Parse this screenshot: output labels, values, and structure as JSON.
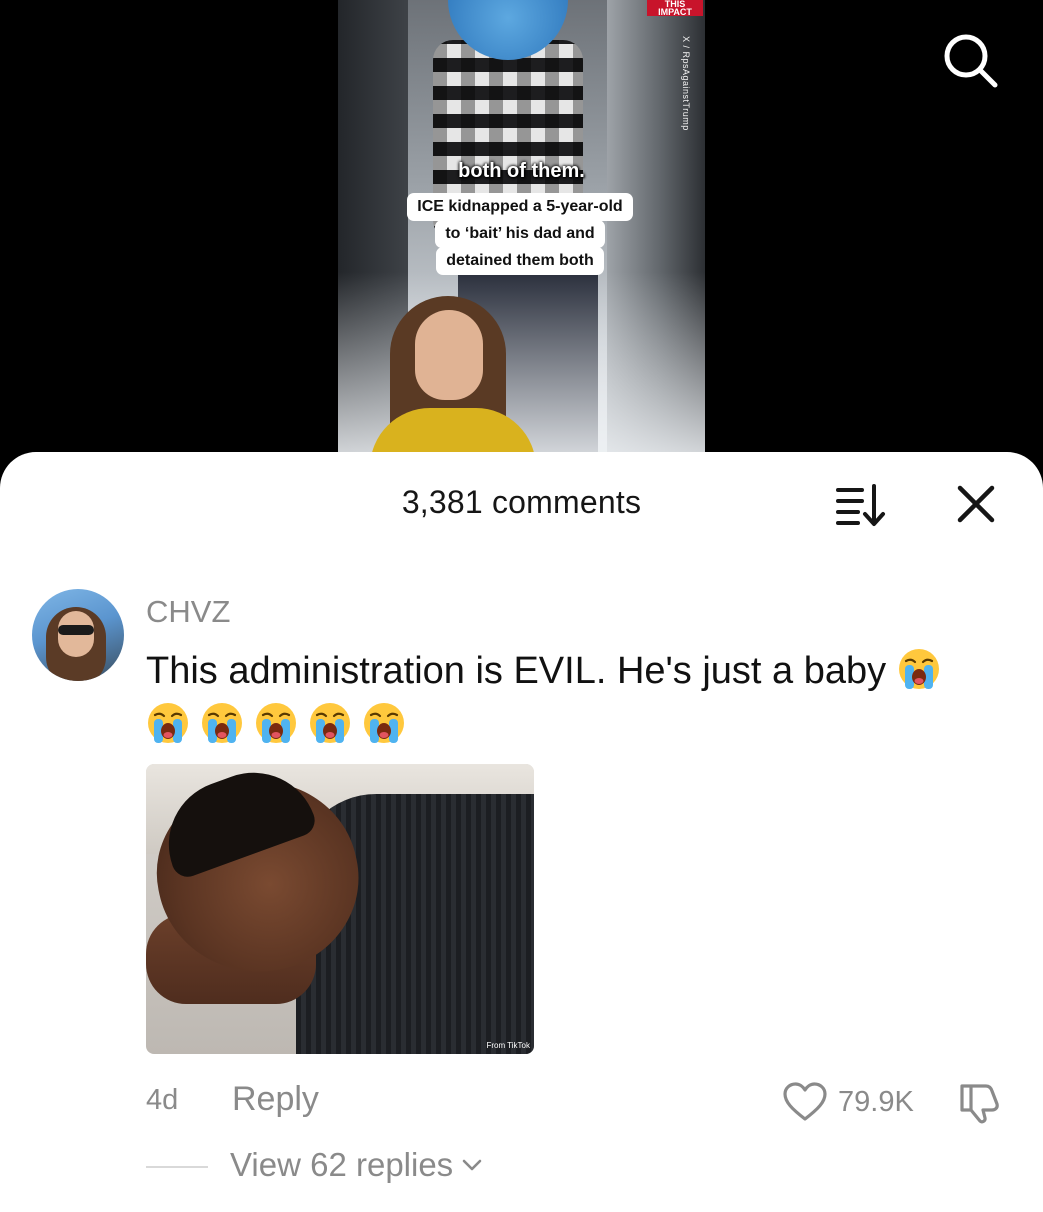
{
  "video": {
    "watermark": "THIS IMPACT",
    "watermark_handle": "X / RpsAgainstTrump",
    "caption_top": "both of them.",
    "caption_lines": [
      "ICE kidnapped a 5-year-old",
      "to ‘bait’ his dad and",
      "detained them both"
    ]
  },
  "header": {
    "search_icon": "search-icon"
  },
  "comments_sheet": {
    "title": "3,381 comments",
    "sort_icon": "sort-icon",
    "close_icon": "close-icon"
  },
  "comment": {
    "username": "CHVZ",
    "text": "This administration is EVIL. He's just a baby",
    "emoji": "😭",
    "emoji_count_total": 6,
    "gif_source_label": "From TikTok",
    "age": "4d",
    "reply_label": "Reply",
    "like_count": "79.9K",
    "view_replies_label": "View 62 replies"
  },
  "colors": {
    "sheet_background": "#ffffff",
    "secondary_text": "#8a8a8a",
    "primary_text": "#111111",
    "video_background": "#000000"
  }
}
